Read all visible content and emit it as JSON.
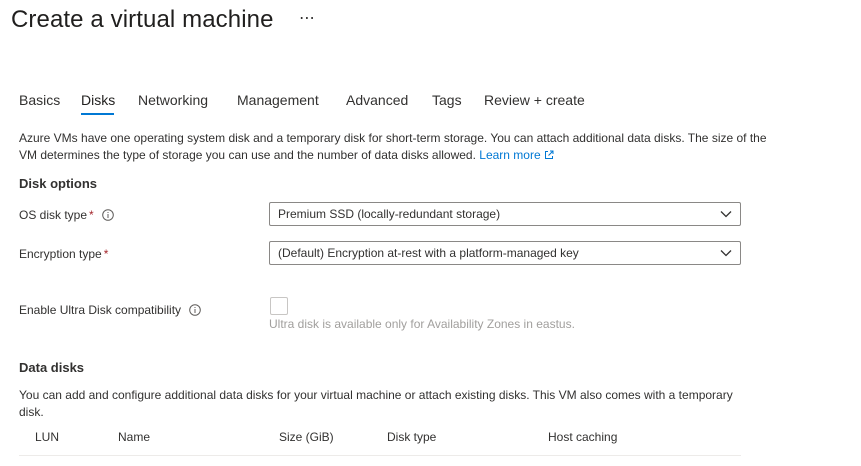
{
  "header": {
    "title": "Create a virtual machine",
    "more_label": "⋯"
  },
  "tabs": [
    {
      "label": "Basics"
    },
    {
      "label": "Disks"
    },
    {
      "label": "Networking"
    },
    {
      "label": "Management"
    },
    {
      "label": "Advanced"
    },
    {
      "label": "Tags"
    },
    {
      "label": "Review + create"
    }
  ],
  "active_tab": "Disks",
  "intro": {
    "text": "Azure VMs have one operating system disk and a temporary disk for short-term storage. You can attach additional data disks. The size of the VM determines the type of storage you can use and the number of data disks allowed.",
    "link_label": "Learn more"
  },
  "disk_options": {
    "title": "Disk options",
    "os_disk_type": {
      "label": "OS disk type",
      "required_mark": "*",
      "value": "Premium SSD (locally-redundant storage)"
    },
    "encryption_type": {
      "label": "Encryption type",
      "required_mark": "*",
      "value": "(Default) Encryption at-rest with a platform-managed key"
    },
    "ultra_disk": {
      "label": "Enable Ultra Disk compatibility",
      "checked": false,
      "helper": "Ultra disk is available only for Availability Zones in eastus."
    }
  },
  "data_disks": {
    "title": "Data disks",
    "description": "You can add and configure additional data disks for your virtual machine or attach existing disks. This VM also comes with a temporary disk.",
    "columns": [
      "LUN",
      "Name",
      "Size (GiB)",
      "Disk type",
      "Host caching"
    ]
  },
  "colors": {
    "accent": "#0078d4",
    "required": "#a4262c",
    "disabled_text": "#a19f9d"
  },
  "icons": {
    "info": "info-icon",
    "chevron": "chevron-down-icon",
    "external": "external-link-icon"
  }
}
